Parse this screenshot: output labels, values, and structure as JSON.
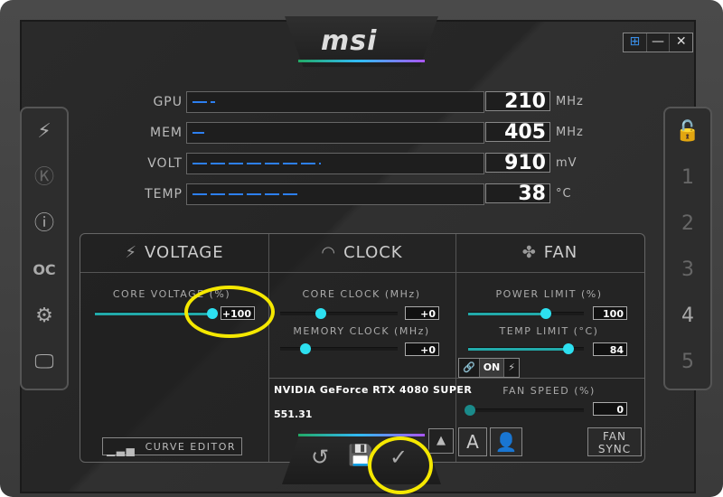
{
  "window": {
    "logo": "msi",
    "controls": [
      "⊞",
      "—",
      "✕"
    ]
  },
  "left_sidebar": [
    {
      "name": "mystic-icon",
      "glyph": "⚡"
    },
    {
      "name": "k-icon",
      "glyph": "Ⓚ"
    },
    {
      "name": "info-icon",
      "glyph": "ⓘ"
    },
    {
      "name": "oc-scanner-icon",
      "glyph": "OC"
    },
    {
      "name": "settings-icon",
      "glyph": "⚙"
    },
    {
      "name": "monitor-icon",
      "glyph": "🖵"
    }
  ],
  "right_sidebar": {
    "lock": "🔓",
    "profiles": [
      "1",
      "2",
      "3",
      "4",
      "5"
    ]
  },
  "monitors": [
    {
      "label": "GPU",
      "value": "210",
      "unit": "MHz",
      "fill": 0.08
    },
    {
      "label": "MEM",
      "value": "405",
      "unit": "MHz",
      "fill": 0.04
    },
    {
      "label": "VOLT",
      "value": "910",
      "unit": "mV",
      "fill": 0.45
    },
    {
      "label": "TEMP",
      "value": "38",
      "unit": "°C",
      "fill": 0.37
    }
  ],
  "voltage": {
    "title": "VOLTAGE",
    "core_voltage_label": "CORE VOLTAGE (%)",
    "core_voltage_value": "+100",
    "core_voltage_level": 1.0,
    "curve_editor": "CURVE EDITOR"
  },
  "clock": {
    "title": "CLOCK",
    "core_clock_label": "CORE CLOCK (MHz)",
    "core_clock_value": "+0",
    "memory_clock_label": "MEMORY CLOCK (MHz)",
    "memory_clock_value": "+0",
    "gpu_name": "NVIDIA GeForce RTX 4080 SUPER",
    "driver": "551.31"
  },
  "fan": {
    "title": "FAN",
    "power_limit_label": "POWER LIMIT (%)",
    "power_limit_value": "100",
    "temp_limit_label": "TEMP LIMIT (°C)",
    "temp_limit_value": "84",
    "link_state": "ON",
    "fan_speed_label": "FAN SPEED (%)",
    "fan_speed_value": "0",
    "auto_label": "A",
    "fan_sync": "FAN SYNC"
  },
  "bottom": {
    "reset": "↺",
    "save": "💾",
    "apply": "✓",
    "up": "▲"
  },
  "colors": {
    "accent": "#2de0f0",
    "monitor_bar": "#2d7ff0",
    "highlight": "#f5e800"
  }
}
